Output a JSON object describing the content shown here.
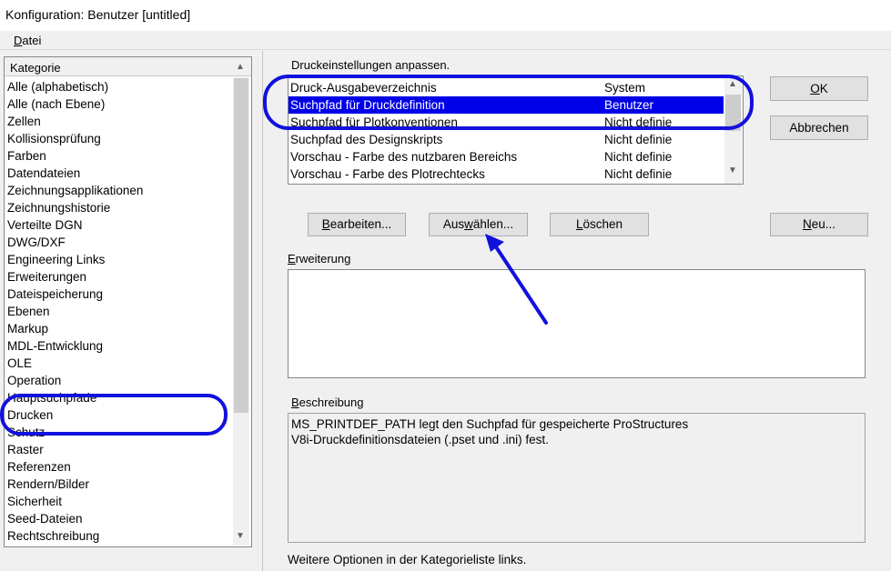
{
  "window": {
    "title": "Konfiguration: Benutzer [untitled]"
  },
  "menu": {
    "datei_underline": "D",
    "datei_rest": "atei"
  },
  "categories": {
    "header_pre": "Kate",
    "header_u": "g",
    "header_post": "orie",
    "items": [
      "Alle (alphabetisch)",
      "Alle (nach Ebene)",
      "Zellen",
      "Kollisionsprüfung",
      "Farben",
      "Datendateien",
      "Zeichnungsapplikationen",
      "Zeichnungshistorie",
      "Verteilte DGN",
      "DWG/DXF",
      "Engineering Links",
      "Erweiterungen",
      "Dateispeicherung",
      "Ebenen",
      "Markup",
      "MDL-Entwicklung",
      "OLE",
      "Operation",
      "Hauptsuchpfade",
      "Drucken",
      "Schutz",
      "Raster",
      "Referenzen",
      "Rendern/Bilder",
      "Sicherheit",
      "Seed-Dateien",
      "Rechtschreibung"
    ],
    "selected": "Drucken"
  },
  "settings": {
    "heading": "Druckeinstellungen anpassen.",
    "rows": [
      {
        "name": "Druck-Ausgabeverzeichnis",
        "value": "System"
      },
      {
        "name": "Suchpfad für Druckdefinition",
        "value": "Benutzer"
      },
      {
        "name": "Suchpfad für Plotkonventionen",
        "value": "Nicht definie"
      },
      {
        "name": "Suchpfad des Designskripts",
        "value": "Nicht definie"
      },
      {
        "name": "Vorschau - Farbe des nutzbaren Bereichs",
        "value": "Nicht definie"
      },
      {
        "name": "Vorschau - Farbe des Plotrechtecks",
        "value": "Nicht definie"
      }
    ],
    "selected_index": 1
  },
  "buttons": {
    "ok": {
      "u": "O",
      "rest": "K"
    },
    "abbrechen": "Abbrechen",
    "bearbeiten": {
      "u": "B",
      "rest": "earbeiten..."
    },
    "auswaehlen": {
      "pre": "Aus",
      "u": "w",
      "rest": "ählen..."
    },
    "loeschen": {
      "u": "L",
      "rest": "öschen"
    },
    "neu": {
      "u": "N",
      "rest": "eu..."
    }
  },
  "erweiterung": {
    "u": "E",
    "rest": "rweiterung"
  },
  "beschreibung": {
    "label_u": "B",
    "label_rest": "eschreibung",
    "line1": "MS_PRINTDEF_PATH legt den Suchpfad für gespeicherte ProStructures",
    "line2": "V8i-Druckdefinitionsdateien  (.pset und .ini) fest."
  },
  "footer": "Weitere Optionen in der Kategorieliste links.",
  "colors": {
    "selection": "#0000e8",
    "annotation": "#1111dd"
  }
}
